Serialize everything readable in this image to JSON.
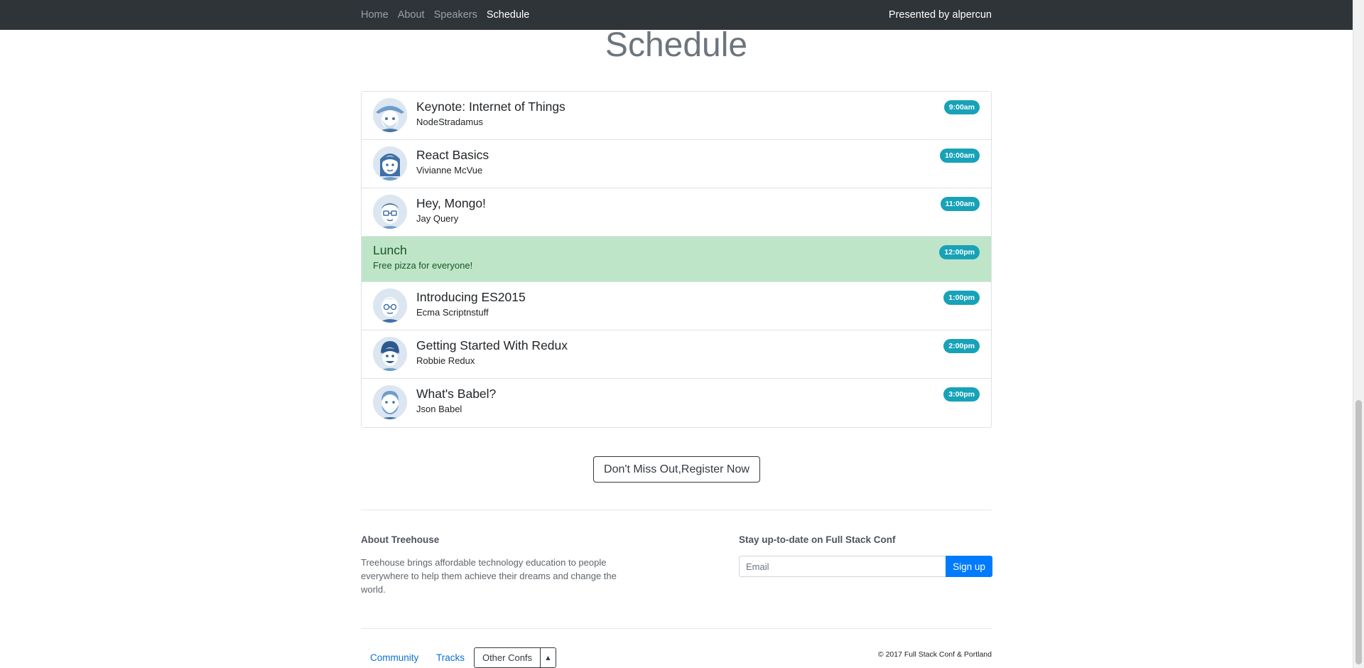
{
  "nav": {
    "links": [
      {
        "label": "Home",
        "active": false
      },
      {
        "label": "About",
        "active": false
      },
      {
        "label": "Speakers",
        "active": false
      },
      {
        "label": "Schedule",
        "active": true
      }
    ],
    "presented_by": "Presented by alpercun"
  },
  "page": {
    "title": "Schedule"
  },
  "schedule": [
    {
      "title": "Keynote: Internet of Things",
      "speaker": "NodeStradamus",
      "time": "9:00am",
      "avatar": "avatar-nodestradamus-icon"
    },
    {
      "title": "React Basics",
      "speaker": "Vivianne McVue",
      "time": "10:00am",
      "avatar": "avatar-vivianne-icon"
    },
    {
      "title": "Hey, Mongo!",
      "speaker": "Jay Query",
      "time": "11:00am",
      "avatar": "avatar-jay-icon"
    },
    {
      "title": "Lunch",
      "speaker": "Free pizza for everyone!",
      "time": "12:00pm",
      "lunch": true
    },
    {
      "title": "Introducing ES2015",
      "speaker": "Ecma Scriptnstuff",
      "time": "1:00pm",
      "avatar": "avatar-ecma-icon"
    },
    {
      "title": "Getting Started With Redux",
      "speaker": "Robbie Redux",
      "time": "2:00pm",
      "avatar": "avatar-robbie-icon"
    },
    {
      "title": "What's Babel?",
      "speaker": "Json Babel",
      "time": "3:00pm",
      "avatar": "avatar-json-icon"
    }
  ],
  "register": {
    "label": "Don't Miss Out,Register Now"
  },
  "footer": {
    "about_heading": "About Treehouse",
    "about_text": "Treehouse brings affordable technology education to people everywhere to help them achieve their dreams and change the world.",
    "stay_heading": "Stay up-to-date on Full Stack Conf",
    "email_placeholder": "Email",
    "signup_label": "Sign up",
    "links": [
      "Community",
      "Tracks"
    ],
    "other_confs_label": "Other Confs",
    "caret_glyph": "▲",
    "copyright": "© 2017 Full Stack Conf & Portland"
  },
  "colors": {
    "navbar": "#2f3439",
    "badge": "#17a2b8",
    "lunch_bg": "#bfe5c8",
    "primary": "#007bff"
  }
}
